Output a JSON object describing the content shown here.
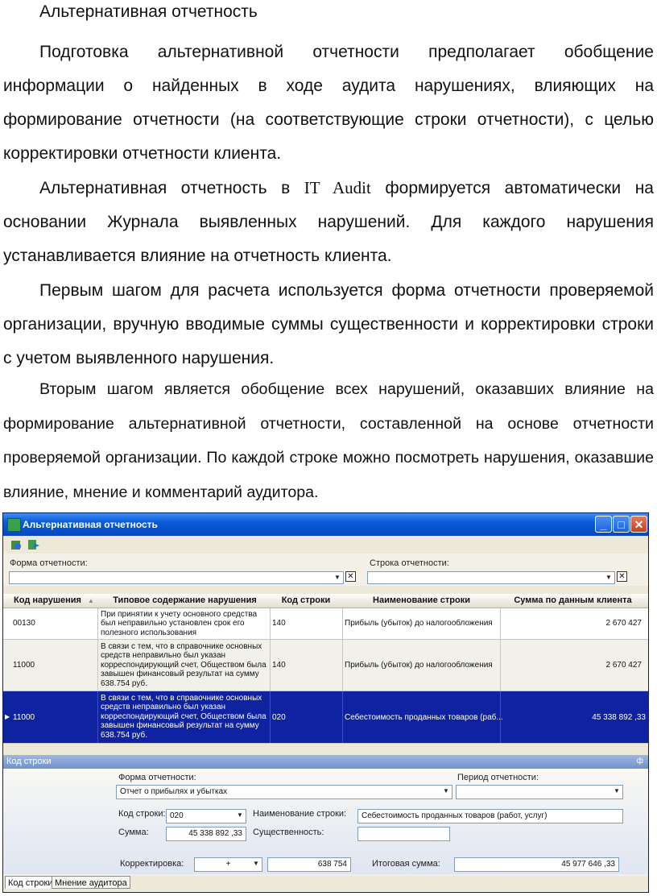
{
  "doc": {
    "heading": "Альтернативная отчетность",
    "para1": "Подготовка альтернативной отчетности предполагает обобщение информации о найденных в ходе аудита нарушениях, влияющих на формирование отчетности (на соответствующие строки отчетности), с целью корректировки отчетности клиента.",
    "para2_a": "Альтернативная отчетность в ",
    "para2_it": "IT Audit",
    "para2_b": " формируется автоматически на основании Журнала выявленных нарушений. Для каждого нарушения устанавливается влияние на отчетность клиента.",
    "para3": "Первым шагом для расчета используется форма отчетности проверяемой организации, вручную вводимые суммы существенности и корректировки строки с учетом выявленного нарушения.",
    "para4": "Вторым шагом является обобщение всех нарушений, оказавших влияние на формирование альтернативной отчетности, составленной на основе отчетности проверяемой организации. По каждой строке можно посмотреть нарушения, оказавшие влияние, мнение и комментарий аудитора."
  },
  "window": {
    "title": "Альтернативная отчетность",
    "filters": {
      "form_label": "Форма отчетности:",
      "row_label": "Строка отчетности:",
      "form_value": "",
      "row_value": ""
    },
    "grid": {
      "headers": [
        "Код нарушения",
        "Типовое содержание нарушения",
        "Код строки",
        "Наименование строки",
        "Сумма по данным клиента"
      ],
      "rows": [
        {
          "code": "00130",
          "content": "При принятии к учету основного средства был неправильно установлен срок его полезного использования",
          "line_code": "140",
          "line_name": "Прибыль (убыток) до налогообложения",
          "amount": "2 670 427"
        },
        {
          "code": "11000",
          "content": "В связи с тем, что в справочнике основных средств неправильно был указан корреспондирующий счет, Обществом была завышен финансовый результат на сумму 638.754 руб.",
          "line_code": "140",
          "line_name": "Прибыль (убыток) до налогообложения",
          "amount": "2 670 427"
        },
        {
          "code": "11000",
          "content": "В связи с тем, что в справочнике основных средств неправильно был указан корреспондирующий счет, Обществом была завышен финансовый результат на сумму 638.754 руб.",
          "line_code": "020",
          "line_name": "Себестоимость проданных товаров (раб...",
          "amount": "45 338 892 ,33"
        }
      ]
    },
    "panel": {
      "title": "Код строки",
      "pin": "ф",
      "form_label": "Форма отчетности:",
      "form_value": "Отчет о прибылях и убытках",
      "period_label": "Период отчетности:",
      "period_value": "",
      "code_label": "Код строки:",
      "code_value": "020",
      "name_label": "Наименование строки:",
      "name_value": "Себестоимость проданных товаров (работ, услуг)",
      "sum_label": "Сумма:",
      "sum_value": "45 338 892 ,33",
      "materiality_label": "Существенность:",
      "materiality_value": "",
      "adjust_label": "Корректировка:",
      "adjust_sign": "+",
      "adjust_value": "638 754",
      "total_label": "Итоговая сумма:",
      "total_value": "45 977 646 ,33"
    },
    "tabs": [
      "Код строки",
      "Мнение аудитора"
    ]
  }
}
